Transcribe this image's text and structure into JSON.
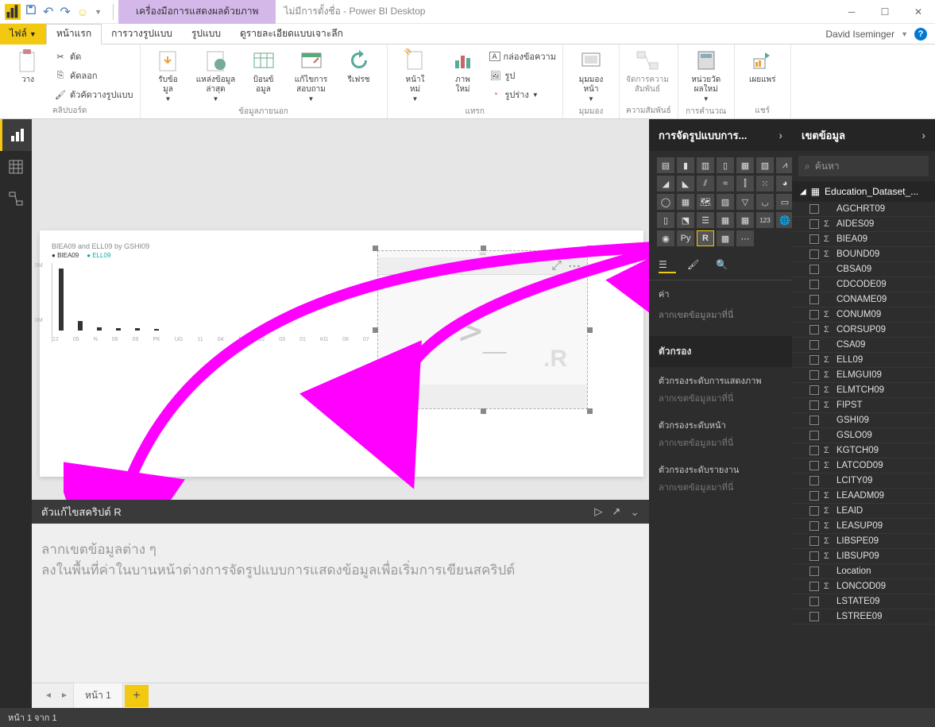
{
  "titlebar": {
    "context_tab": "เครื่องมือการแสดงผลด้วยภาพ",
    "title": "ไม่มีการตั้งชื่อ - Power BI Desktop"
  },
  "ribbon_tabs": {
    "file": "ไฟล์",
    "home": "หน้าแรก",
    "modeling": "การวางรูปแบบ",
    "format": "รูปแบบ",
    "drill": "ดูรายละเอียดแบบเจาะลึก",
    "user": "David Iseminger"
  },
  "ribbon": {
    "clipboard": {
      "paste": "วาง",
      "cut": "ตัด",
      "copy": "คัดลอก",
      "formatpainter": "ตัวคัดวางรูปแบบ",
      "group": "คลิปบอร์ด"
    },
    "external": {
      "getdata": "รับข้อ\nมูล",
      "recent": "แหล่งข้อมูล\nล่าสุด",
      "enter": "ป้อนข้\nอมูล",
      "edit": "แก้ไขการ\nสอบถาม",
      "refresh": "รีเฟรช",
      "group": "ข้อมูลภายนอก"
    },
    "insert": {
      "newpage": "หน้าใ\nหม่",
      "newvisual": "ภาพ\nใหม่",
      "textbox": "กล่องข้อความ",
      "image": "รูป",
      "shapes": "รูปร่าง",
      "group": "แทรก"
    },
    "view": {
      "view": "มุมมอง\nหน้า",
      "group": "มุมมอง"
    },
    "relationships": {
      "manage": "จัดการความ\nสัมพันธ์",
      "group": "ความสัมพันธ์"
    },
    "calc": {
      "measure": "หน่วยวัด\nผลใหม่",
      "group": "การคำนวณ"
    },
    "share": {
      "publish": "เผยแพร่",
      "group": "แชร์"
    }
  },
  "viz_pane": {
    "title": "การจัดรูปแบบการ...",
    "value_label": "ค่า",
    "drag_here": "ลากเขตข้อมูลมาที่นี่",
    "filters_title": "ตัวกรอง",
    "visual_filters": "ตัวกรองระดับการแสดงภาพ",
    "page_filters": "ตัวกรองระดับหน้า",
    "report_filters": "ตัวกรองระดับรายงาน"
  },
  "fields_pane": {
    "title": "เขตข้อมูล",
    "search_placeholder": "ค้นหา",
    "table_name": "Education_Dataset_...",
    "fields": [
      {
        "name": "AGCHRT09",
        "sum": false
      },
      {
        "name": "AIDES09",
        "sum": true
      },
      {
        "name": "BIEA09",
        "sum": true
      },
      {
        "name": "BOUND09",
        "sum": true
      },
      {
        "name": "CBSA09",
        "sum": false
      },
      {
        "name": "CDCODE09",
        "sum": false
      },
      {
        "name": "CONAME09",
        "sum": false
      },
      {
        "name": "CONUM09",
        "sum": true
      },
      {
        "name": "CORSUP09",
        "sum": true
      },
      {
        "name": "CSA09",
        "sum": false
      },
      {
        "name": "ELL09",
        "sum": true
      },
      {
        "name": "ELMGUI09",
        "sum": true
      },
      {
        "name": "ELMTCH09",
        "sum": true
      },
      {
        "name": "FIPST",
        "sum": true
      },
      {
        "name": "GSHI09",
        "sum": false
      },
      {
        "name": "GSLO09",
        "sum": false
      },
      {
        "name": "KGTCH09",
        "sum": true
      },
      {
        "name": "LATCOD09",
        "sum": true
      },
      {
        "name": "LCITY09",
        "sum": false
      },
      {
        "name": "LEAADM09",
        "sum": true
      },
      {
        "name": "LEAID",
        "sum": true
      },
      {
        "name": "LEASUP09",
        "sum": true
      },
      {
        "name": "LIBSPE09",
        "sum": true
      },
      {
        "name": "LIBSUP09",
        "sum": true
      },
      {
        "name": "Location",
        "sum": false
      },
      {
        "name": "LONCOD09",
        "sum": true
      },
      {
        "name": "LSTATE09",
        "sum": false
      },
      {
        "name": "LSTREE09",
        "sum": false
      }
    ]
  },
  "canvas": {
    "chart_title": "BIEA09 and ELL09 by GSHI09",
    "legend": [
      "BIEA09",
      "ELL09"
    ],
    "r_editor_title": "ตัวแก้ไขสคริปต์ R",
    "r_editor_hint1": "ลากเขตข้อมูลต่าง ๆ",
    "r_editor_hint2": "ลงในพื้นที่ค่าในบานหน้าต่างการจัดรูปแบบการแสดงข้อมูลเพื่อเริ่มการเขียนสคริปต์",
    "r_prompt": ">_"
  },
  "page_tabs": {
    "page1": "หน้า 1"
  },
  "statusbar": {
    "text": "หน้า 1 จาก 1"
  },
  "chart_data": {
    "type": "bar",
    "title": "BIEA09 and ELL09 by GSHI09",
    "categories": [
      "12",
      "05",
      "N",
      "06",
      "09",
      "PK",
      "UG",
      "11",
      "04",
      "10",
      "02",
      "03",
      "01",
      "KG",
      "08",
      "07"
    ],
    "series": [
      {
        "name": "BIEA09",
        "values": [
          5,
          0.8,
          0.2,
          0.15,
          0.1,
          0.1,
          0.08,
          0.08,
          0.05,
          0.05,
          0.05,
          0.05,
          0.05,
          0.05,
          0.03,
          0.03
        ]
      },
      {
        "name": "ELL09",
        "values": [
          0.05,
          0.05,
          0.02,
          0.02,
          0.02,
          0.02,
          0.01,
          0.01,
          0.01,
          0.01,
          0.01,
          0.01,
          0.01,
          0.01,
          0.01,
          0.01
        ]
      }
    ],
    "ylabel": "",
    "ylim": [
      0,
      5
    ],
    "yticks": [
      "0M",
      "5M"
    ]
  }
}
